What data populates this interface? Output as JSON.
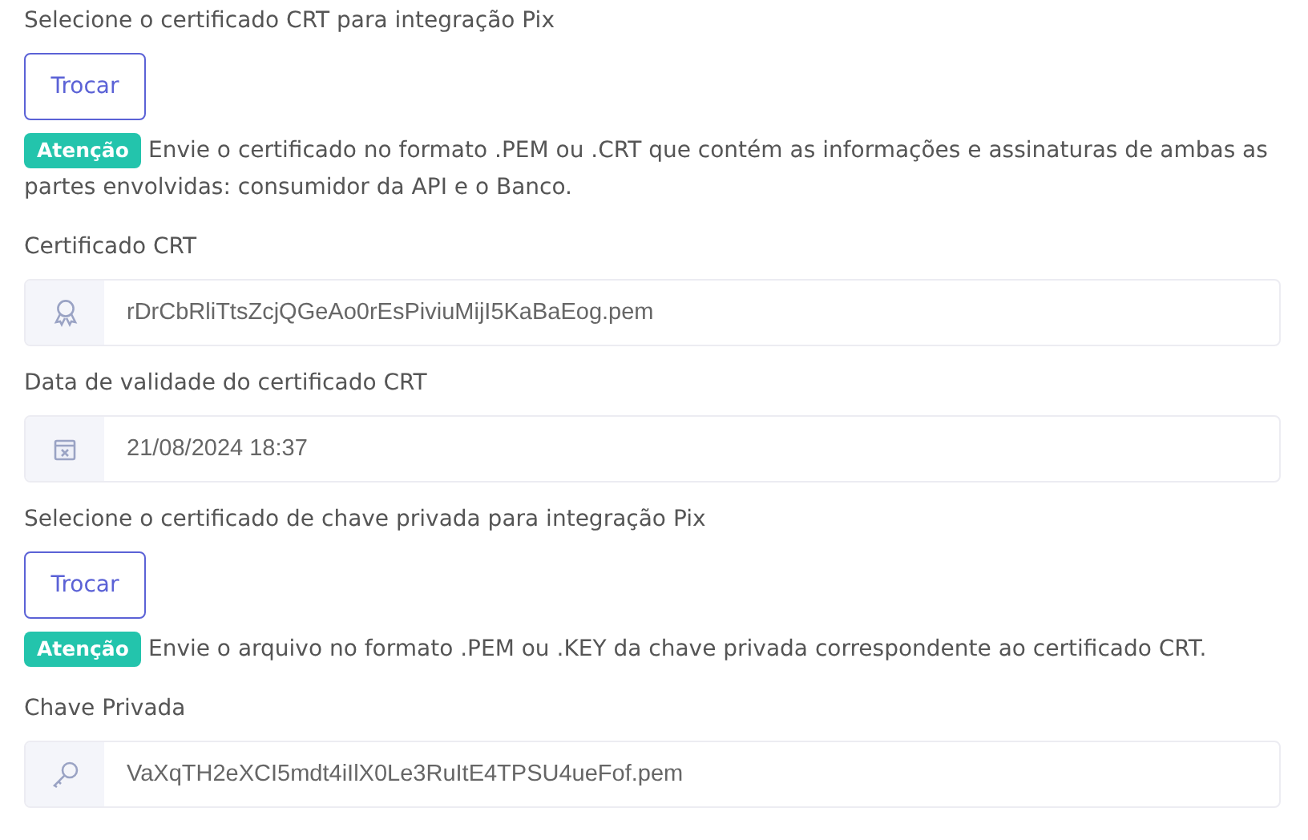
{
  "sections": [
    {
      "kind": "upload",
      "label": "Selecione o certificado CRT para integração Pix",
      "button": "Trocar",
      "badge": "Atenção",
      "notice": "Envie o certificado no formato .PEM ou .CRT que contém as informações e assinaturas de ambas as partes envolvidas: consumidor da API e o Banco."
    },
    {
      "kind": "certificate",
      "label": "Certificado CRT",
      "value": "rDrCbRliTtsZcjQGeAo0rEsPiviuMijI5KaBaEog.pem"
    },
    {
      "kind": "date",
      "label": "Data de validade do certificado CRT",
      "value": "21/08/2024 18:37"
    },
    {
      "kind": "upload",
      "label": "Selecione o certificado de chave privada para integração Pix",
      "button": "Trocar",
      "badge": "Atenção",
      "notice": "Envie o arquivo no formato .PEM ou .KEY da chave privada correspondente ao certificado CRT."
    },
    {
      "kind": "key",
      "label": "Chave Privada",
      "value": "VaXqTH2eXCI5mdt4iIlX0Le3RuItE4TPSU4ueFof.pem"
    }
  ]
}
